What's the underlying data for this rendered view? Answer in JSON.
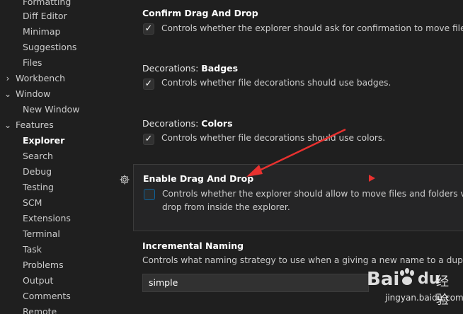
{
  "sidebar": {
    "items": [
      {
        "label": "Formatting"
      },
      {
        "label": "Diff Editor"
      },
      {
        "label": "Minimap"
      },
      {
        "label": "Suggestions"
      },
      {
        "label": "Files"
      },
      {
        "label": "Workbench"
      },
      {
        "label": "Window"
      },
      {
        "label": "New Window"
      },
      {
        "label": "Features"
      },
      {
        "label": "Explorer"
      },
      {
        "label": "Search"
      },
      {
        "label": "Debug"
      },
      {
        "label": "Testing"
      },
      {
        "label": "SCM"
      },
      {
        "label": "Extensions"
      },
      {
        "label": "Terminal"
      },
      {
        "label": "Task"
      },
      {
        "label": "Problems"
      },
      {
        "label": "Output"
      },
      {
        "label": "Comments"
      },
      {
        "label": "Remote"
      }
    ],
    "chevrons": {
      "collapsed": "›",
      "expanded": "⌄"
    }
  },
  "settings": {
    "confirm_drag": {
      "title": "Confirm Drag And Drop",
      "description": "Controls whether the explorer should ask for confirmation to move files and",
      "checked": true
    },
    "badges": {
      "category": "Decorations: ",
      "name": "Badges",
      "description": "Controls whether file decorations should use badges.",
      "checked": true
    },
    "colors": {
      "category": "Decorations: ",
      "name": "Colors",
      "description": "Controls whether file decorations should use colors.",
      "checked": true
    },
    "enable_drag": {
      "title": "Enable Drag And Drop",
      "description_line1": "Controls whether the explorer should allow to move files and folders via dr",
      "description_line2": "drop from inside the explorer.",
      "checked": false
    },
    "incremental": {
      "title": "Incremental Naming",
      "description": "Controls what naming strategy to use when a giving a new name to a duplicate",
      "value": "simple"
    }
  },
  "icons": {
    "check": "✓",
    "gear": "gear-icon"
  },
  "watermark": {
    "brand": "Bai",
    "brand2": "du",
    "cn": "经验",
    "url": "jingyan.baidu.com"
  },
  "colors": {
    "accent": "#0e639c",
    "annotation": "#e8312f"
  }
}
